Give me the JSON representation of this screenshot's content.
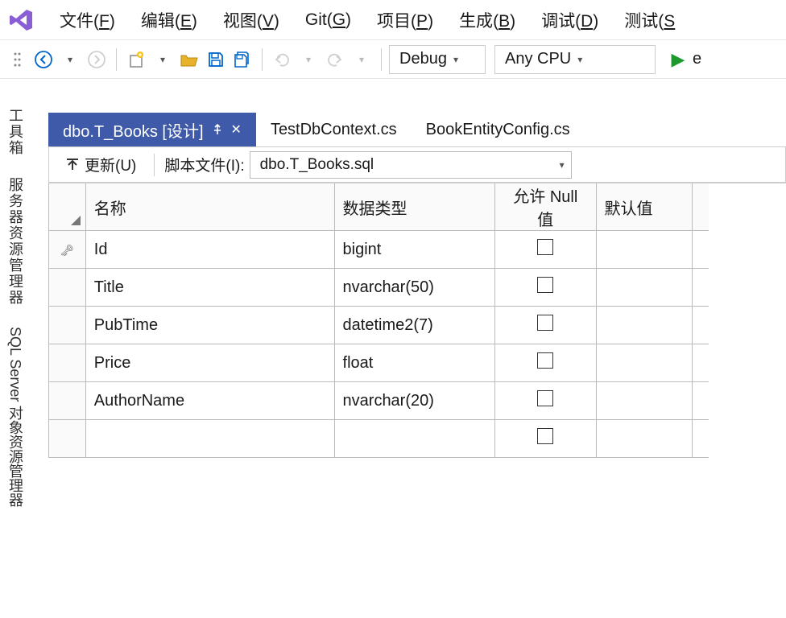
{
  "menubar": {
    "items": [
      {
        "label": "文件",
        "hotkey": "F"
      },
      {
        "label": "编辑",
        "hotkey": "E"
      },
      {
        "label": "视图",
        "hotkey": "V"
      },
      {
        "label": "Git",
        "hotkey": "G"
      },
      {
        "label": "项目",
        "hotkey": "P"
      },
      {
        "label": "生成",
        "hotkey": "B"
      },
      {
        "label": "调试",
        "hotkey": "D"
      },
      {
        "label": "测试",
        "hotkey": "S"
      }
    ]
  },
  "toolbar": {
    "config_dropdown": "Debug",
    "platform_dropdown": "Any CPU",
    "run_extra": "e"
  },
  "side_tabs": [
    "工具箱",
    "服务器资源管理器",
    "SQL Server 对象资源管理器"
  ],
  "doc_tabs": [
    {
      "label": "dbo.T_Books [设计]",
      "active": true,
      "pinned": true
    },
    {
      "label": "TestDbContext.cs",
      "active": false
    },
    {
      "label": "BookEntityConfig.cs",
      "active": false
    }
  ],
  "designer_bar": {
    "update_label": "更新(U)",
    "script_label": "脚本文件(I):",
    "script_file": "dbo.T_Books.sql"
  },
  "grid": {
    "headers": {
      "name": "名称",
      "type": "数据类型",
      "null": "允许 Null 值",
      "default": "默认值"
    },
    "rows": [
      {
        "is_pk": true,
        "name": "Id",
        "type": "bigint",
        "allow_null": false,
        "default": ""
      },
      {
        "is_pk": false,
        "name": "Title",
        "type": "nvarchar(50)",
        "allow_null": false,
        "default": ""
      },
      {
        "is_pk": false,
        "name": "PubTime",
        "type": "datetime2(7)",
        "allow_null": false,
        "default": ""
      },
      {
        "is_pk": false,
        "name": "Price",
        "type": "float",
        "allow_null": false,
        "default": ""
      },
      {
        "is_pk": false,
        "name": "AuthorName",
        "type": "nvarchar(20)",
        "allow_null": false,
        "default": ""
      },
      {
        "is_pk": false,
        "name": "",
        "type": "",
        "allow_null": false,
        "default": ""
      }
    ]
  }
}
